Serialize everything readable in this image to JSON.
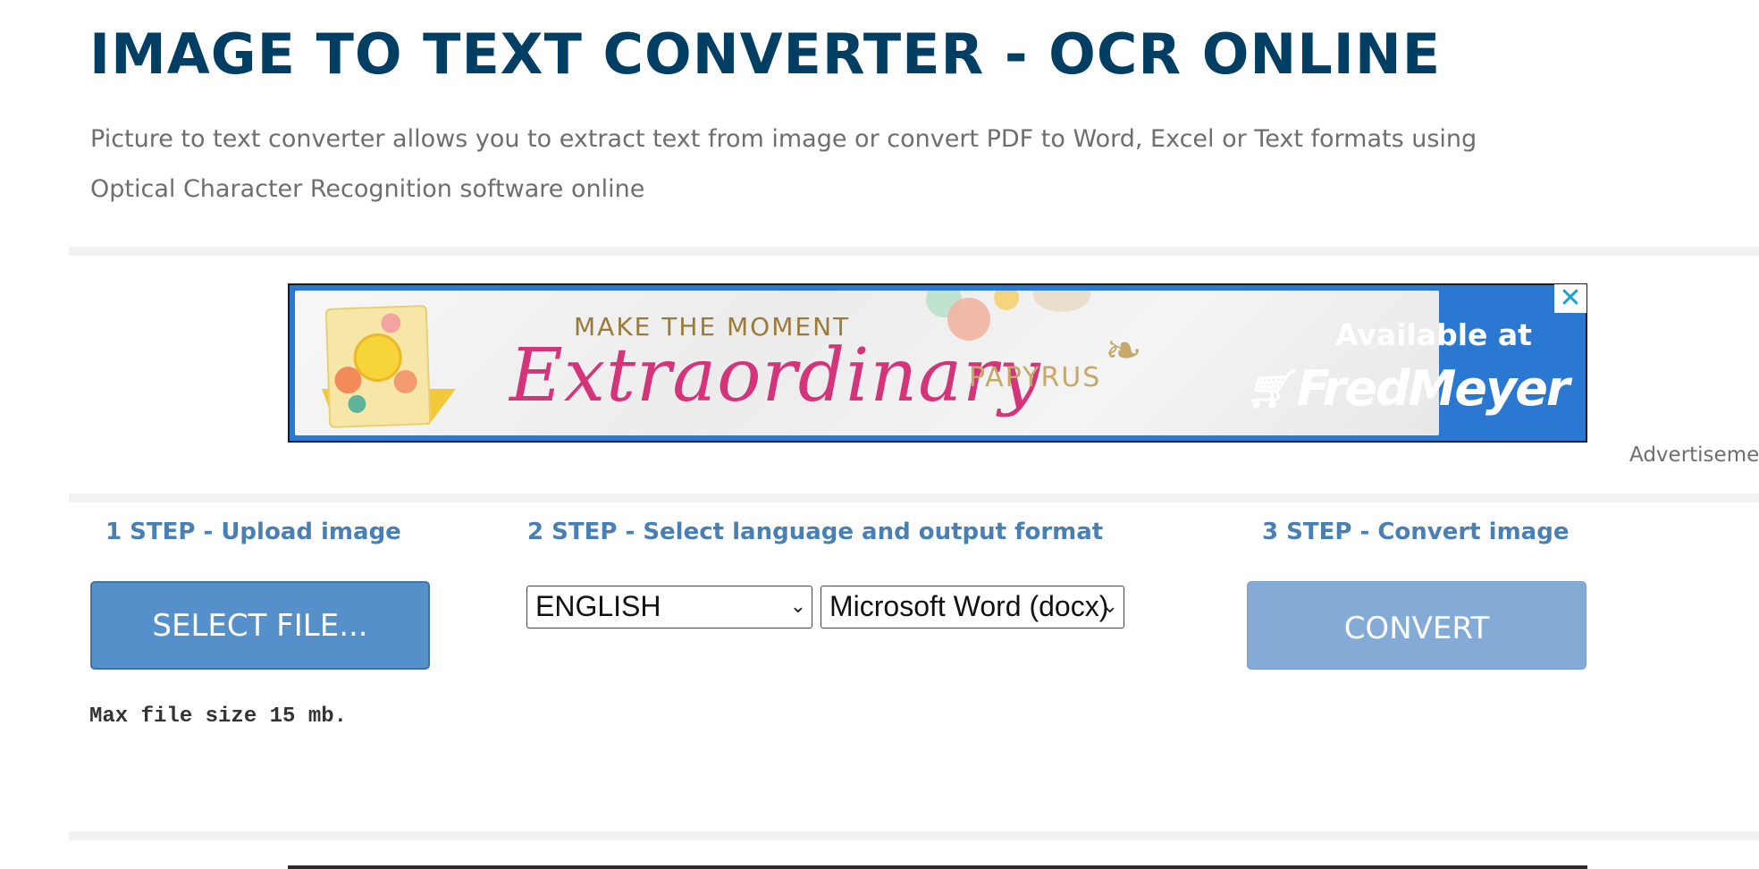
{
  "header": {
    "title": "IMAGE TO TEXT CONVERTER - OCR ONLINE",
    "subtitle": "Picture to text converter allows you to extract text from image or convert PDF to Word, Excel or Text formats using Optical Character Recognition software online"
  },
  "ad": {
    "headline": "MAKE THE MOMENT",
    "script_text": "Extraordinary",
    "brand": "PAPYRUS",
    "available": "Available at",
    "retailer": "FredMeyer",
    "close_icon": "close-icon",
    "label": "Advertiseme"
  },
  "steps": {
    "step1": {
      "heading": "1 STEP - Upload image",
      "button_label": "SELECT FILE...",
      "note": "Max file size 15 mb."
    },
    "step2": {
      "heading": "2 STEP - Select language and output format",
      "language_value": "ENGLISH",
      "format_value": "Microsoft Word (docx)"
    },
    "step3": {
      "heading": "3 STEP - Convert image",
      "button_label": "CONVERT"
    }
  },
  "colors": {
    "title": "#003f63",
    "step_heading": "#4a7fb3",
    "select_button": "#5690cb",
    "convert_button": "#83abd5",
    "ad_blue": "#2a78d2",
    "script_pink": "#d4357a"
  }
}
